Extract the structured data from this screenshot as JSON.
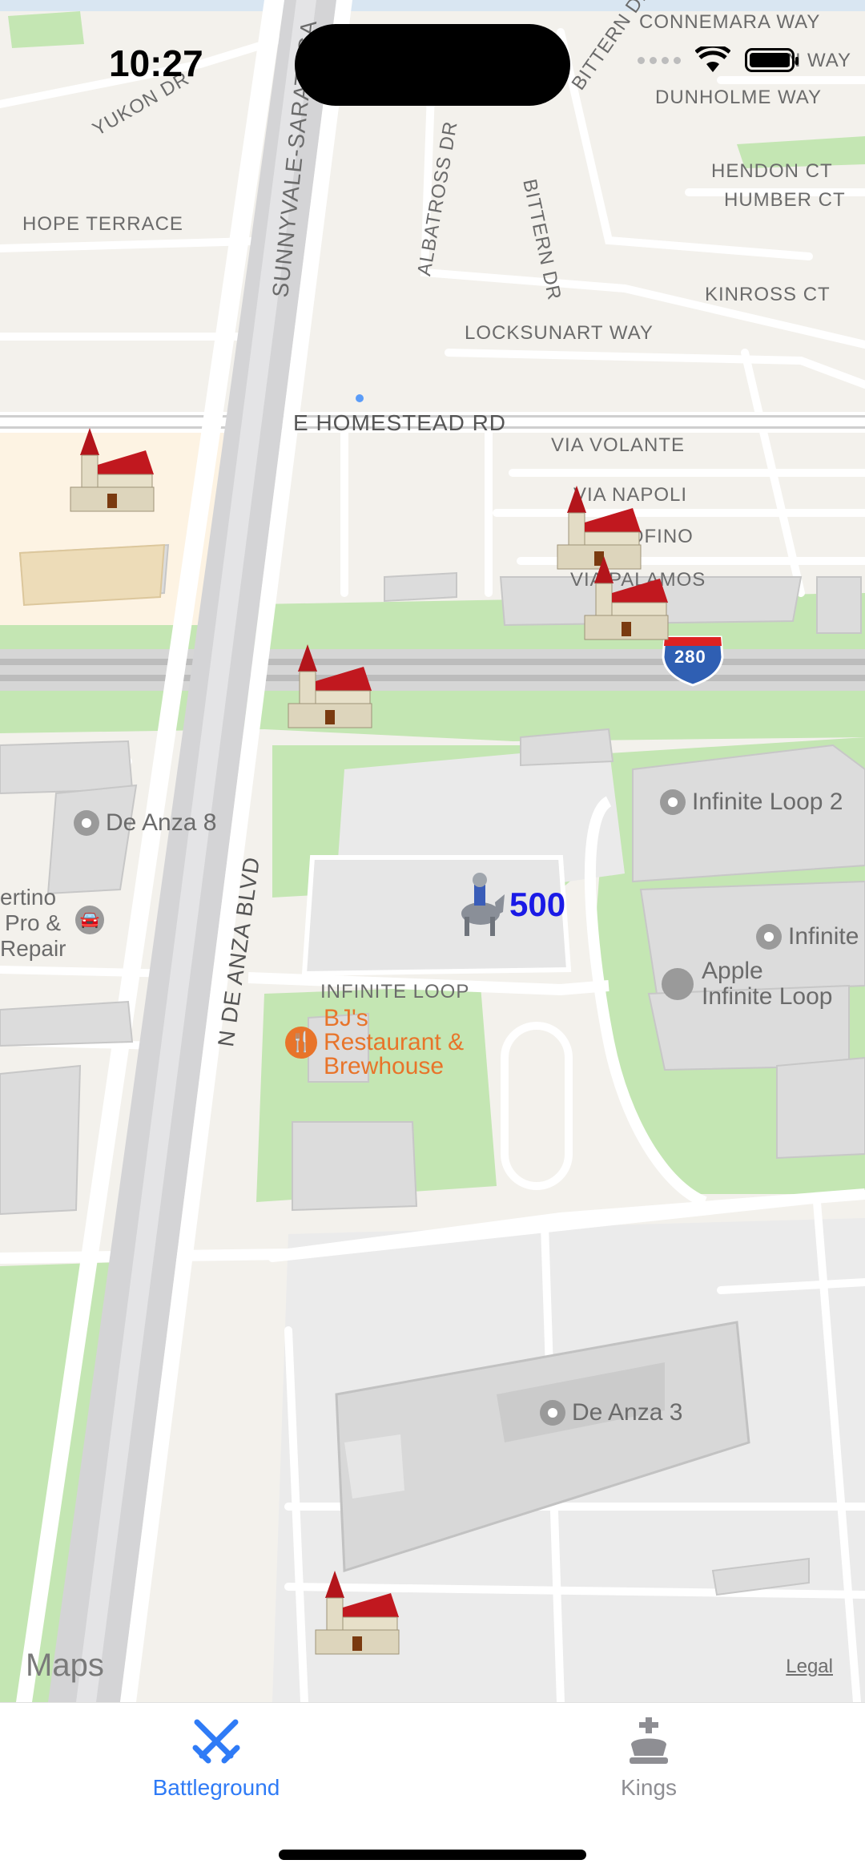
{
  "status_bar": {
    "time": "10:27"
  },
  "map": {
    "streets": {
      "connemara": "CONNEMARA WAY",
      "lin_way": "LIN WAY",
      "dunholme": "DUNHOLME WAY",
      "yukon": "YUKON DR",
      "bittern_top": "BITTERN DR",
      "bittern": "BITTERN DR",
      "albatross": "ALBATROSS DR",
      "sunnyvale": "SUNNYVALE-SARATOGA",
      "hendon": "HENDON CT",
      "humber": "HUMBER CT",
      "hope": "HOPE TERRACE",
      "kinross": "KINROSS CT",
      "locksunart": "LOCKSUNART WAY",
      "homestead": "E HOMESTEAD RD",
      "via_volante": "VIA VOLANTE",
      "via_napoli": "VIA NAPOLI",
      "via_tofino": "VIA TOFINO",
      "via_palamos": "VIA PALAMOS",
      "de_anza_blvd": "N DE ANZA BLVD",
      "infinite_loop": "INFINITE LOOP",
      "interstate": "280"
    },
    "pois": {
      "de_anza_8": "De Anza 8",
      "infinite_loop_2": "Infinite Loop 2",
      "infinite_partial": "Infinite",
      "apple_line1": "Apple",
      "apple_line2": "Infinite Loop",
      "de_anza_3": "De Anza 3",
      "auto_line1": "ertino",
      "auto_line2": "Pro &",
      "auto_line3": "Repair",
      "bjs_line1": "BJ's",
      "bjs_line2": "Restaurant &",
      "bjs_line3": "Brewhouse"
    },
    "player": {
      "score": "500"
    },
    "attribution": {
      "logo": "Maps",
      "legal": "Legal"
    }
  },
  "tabs": [
    {
      "label": "Battleground",
      "icon": "crossed-swords-icon",
      "active": true
    },
    {
      "label": "Kings",
      "icon": "king-crown-icon",
      "active": false
    }
  ],
  "colors": {
    "accent": "#2f7bf6",
    "inactive": "#8e8e93",
    "score": "#1a1ae6",
    "poi_orange": "#e8742a",
    "park_green": "#c4e6b3"
  }
}
